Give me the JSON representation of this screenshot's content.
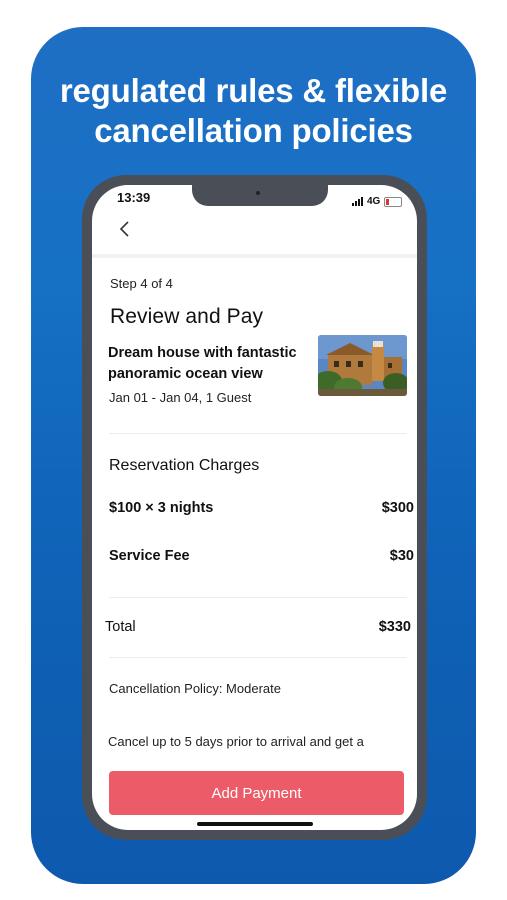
{
  "promo": {
    "headline_line1": "regulated rules & flexible",
    "headline_line2": "cancellation policies",
    "background_color": "#1670c4"
  },
  "status_bar": {
    "time": "13:39",
    "network": "4G"
  },
  "header": {
    "back_icon": "chevron-left-icon"
  },
  "booking": {
    "step": "Step 4 of 4",
    "title": "Review and Pay",
    "listing_title": "Dream house with fantastic panoramic ocean view",
    "dates_guests": "Jan 01 - Jan 04, 1 Guest"
  },
  "charges": {
    "section_title": "Reservation Charges",
    "rows": [
      {
        "label": "$100 × 3 nights",
        "value": "$300"
      },
      {
        "label": "Service Fee",
        "value": "$30"
      }
    ],
    "total_label": "Total",
    "total_value": "$330"
  },
  "policy": {
    "label": "Cancellation Policy: Moderate",
    "detail": "Cancel up to 5 days prior to arrival and get a"
  },
  "actions": {
    "add_payment_label": "Add Payment",
    "button_color": "#ec5b68"
  }
}
